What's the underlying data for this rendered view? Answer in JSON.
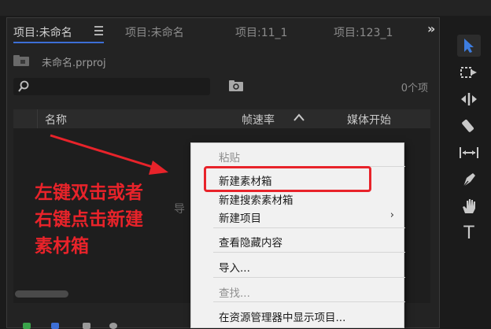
{
  "project_panel": {
    "tabs": [
      {
        "label": "项目:未命名"
      },
      {
        "label": "项目:未命名"
      },
      {
        "label": "项目:11_1"
      },
      {
        "label": "项目:123_1"
      }
    ],
    "project_file": "未命名.prproj",
    "search_placeholder": "",
    "item_count": "0个项",
    "columns": {
      "name": "名称",
      "frame_rate": "帧速率",
      "media_start": "媒体开始"
    },
    "hint": "导"
  },
  "context_menu": {
    "items": [
      {
        "label": "粘贴",
        "disabled": true
      },
      {
        "label": "新建素材箱",
        "highlighted": true
      },
      {
        "label": "新建搜索素材箱"
      },
      {
        "label": "新建项目",
        "submenu": true
      },
      {
        "label": "查看隐藏内容"
      },
      {
        "label": "导入..."
      },
      {
        "label": "查找...",
        "disabled": true
      },
      {
        "label": "在资源管理器中显示项目..."
      }
    ],
    "submenu_arrow": "›"
  },
  "annotation": {
    "lines": [
      "左键双击或者",
      "右键点击新建",
      "素材箱"
    ],
    "color": "#e8232a"
  },
  "tools": [
    {
      "icon": "selection-arrow-icon",
      "selected": true
    },
    {
      "icon": "track-select-forward-icon"
    },
    {
      "icon": "ripple-edit-icon"
    },
    {
      "icon": "razor-icon"
    },
    {
      "icon": "slip-icon"
    },
    {
      "icon": "pen-icon"
    },
    {
      "icon": "hand-icon"
    },
    {
      "icon": "type-icon",
      "glyph": "T"
    }
  ],
  "colors": {
    "accent": "#3d6fd6",
    "highlight": "#e8232a",
    "panel_bg": "#232323",
    "menu_bg": "#f1f1f1"
  }
}
